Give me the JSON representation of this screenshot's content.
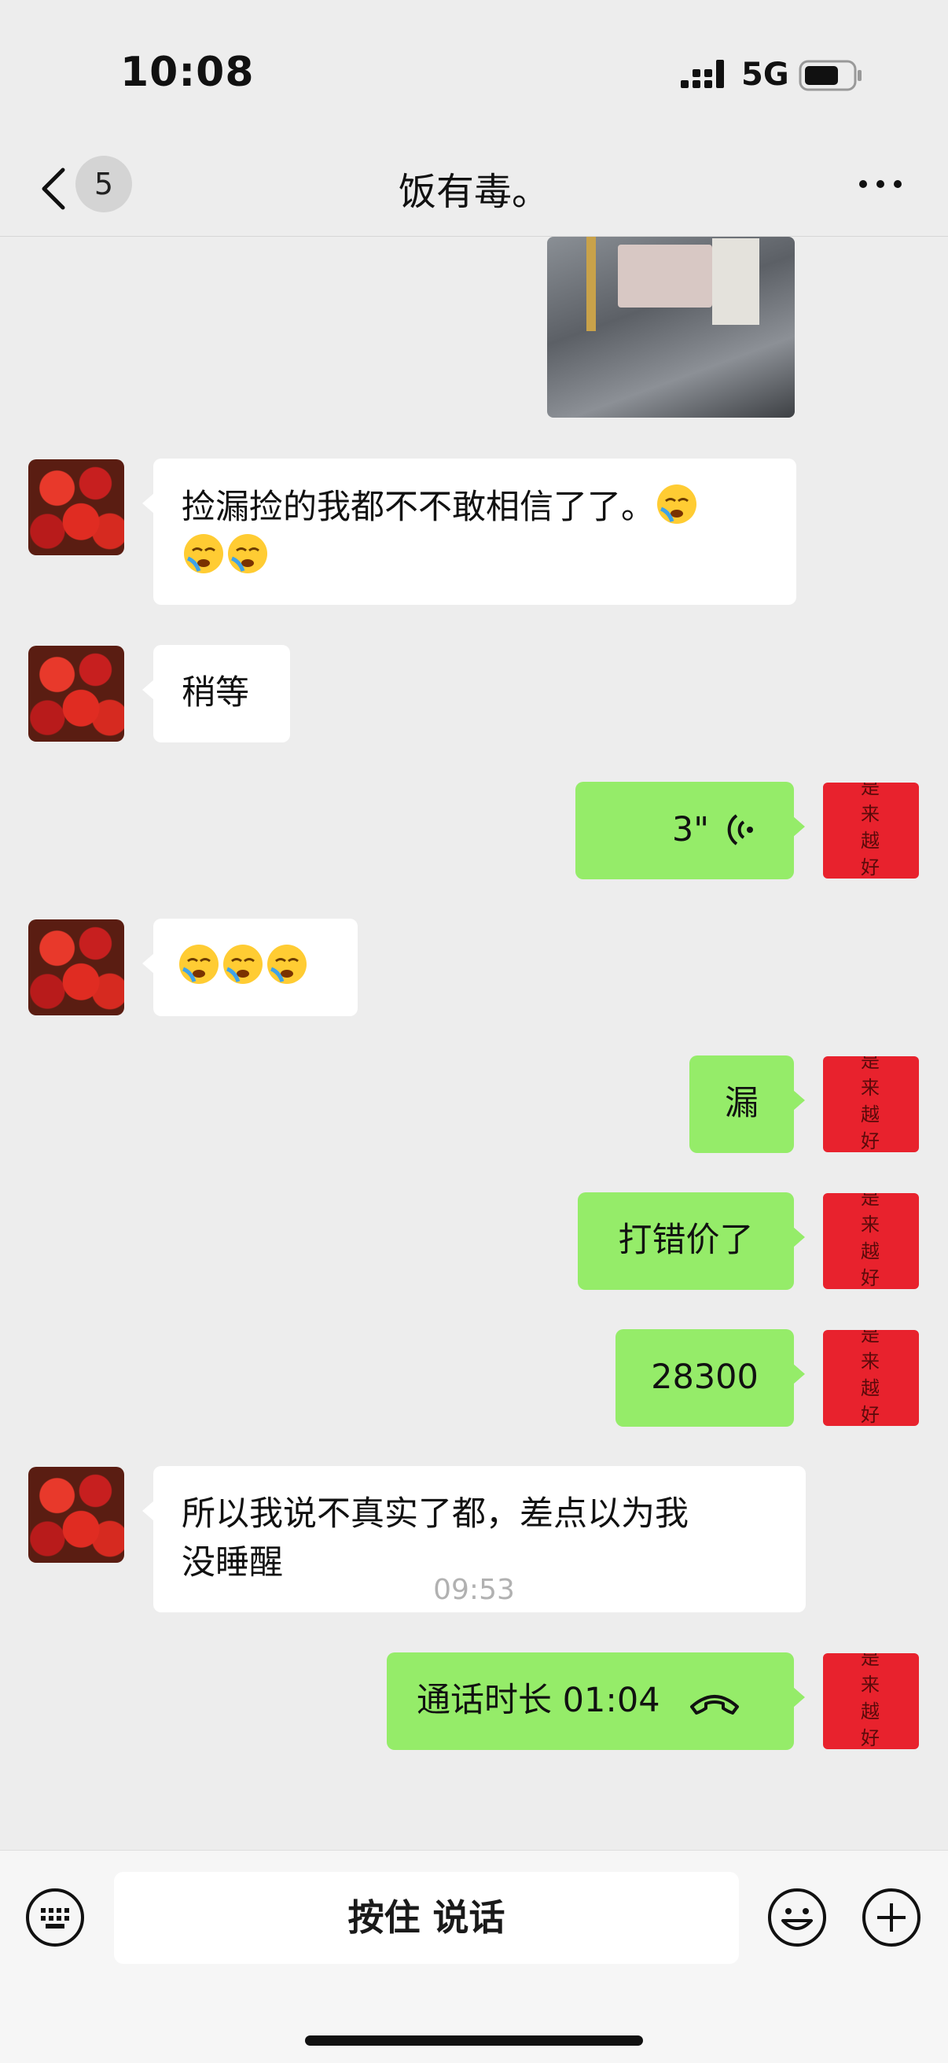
{
  "status_bar": {
    "time": "10:08",
    "network": "5G"
  },
  "nav": {
    "unread_count": "5",
    "title": "饭有毒。"
  },
  "messages": [
    {
      "side": "in",
      "text_line1": "捡漏捡的我都不不敢相信了了。",
      "text_line2": ""
    },
    {
      "side": "in",
      "text": "稍等"
    },
    {
      "side": "out",
      "type": "voice",
      "duration": "3\""
    },
    {
      "side": "in",
      "type": "emoji",
      "emoji_count": 3
    },
    {
      "side": "out",
      "text": "漏"
    },
    {
      "side": "out",
      "text": "打错价了"
    },
    {
      "side": "out",
      "text": "28300"
    },
    {
      "side": "in",
      "text_line1": "所以我说不真实了都，差点以为我",
      "text_line2": "没睡醒"
    },
    {
      "side": "out",
      "type": "call",
      "text": "通话时长 01:04"
    }
  ],
  "timestamp": "09:53",
  "input": {
    "hold_to_talk": "按住 说话"
  },
  "avatar_out_text": "是来越好"
}
